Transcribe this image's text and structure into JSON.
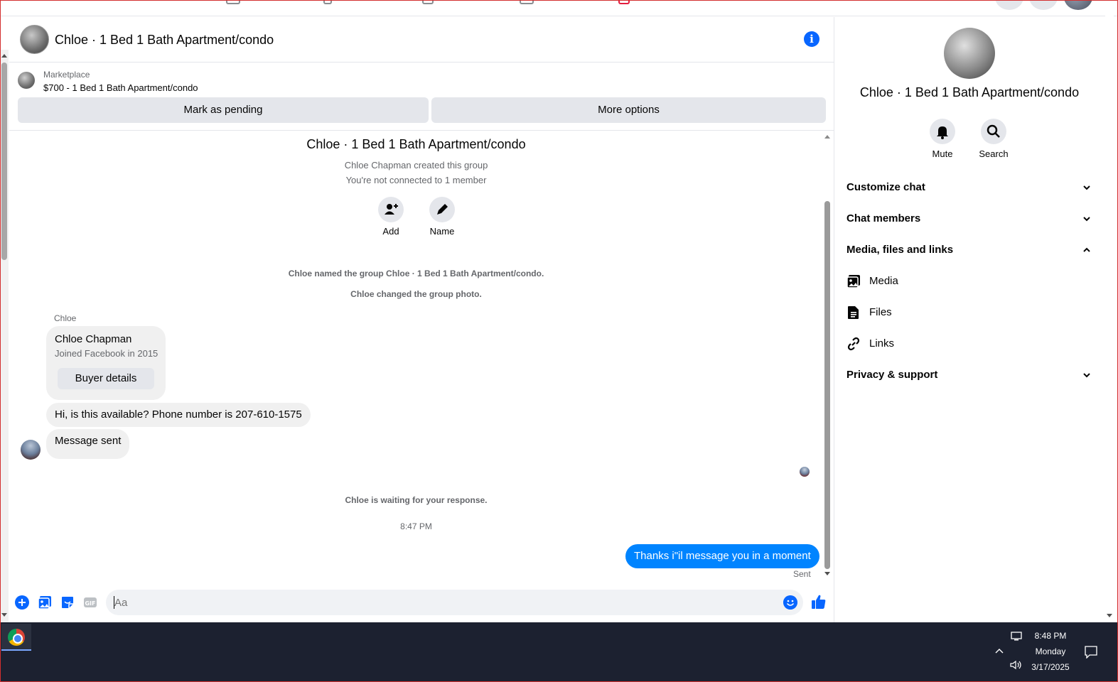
{
  "chat": {
    "title": "Chloe · 1 Bed 1 Bath Apartment/condo",
    "marketplace_label": "Marketplace",
    "listing": "$700 - 1 Bed 1 Bath Apartment/condo",
    "mark_pending": "Mark as pending",
    "more_options": "More options"
  },
  "thread": {
    "group_title": "Chloe · 1 Bed 1 Bath Apartment/condo",
    "created_by": "Chloe Chapman created this group",
    "not_connected": "You're not connected to 1 member",
    "add_label": "Add",
    "name_label": "Name",
    "event_named": "Chloe named the group Chloe · 1 Bed 1 Bath Apartment/condo.",
    "event_photo": "Chloe changed the group photo.",
    "sender": "Chloe",
    "card_name": "Chloe Chapman",
    "card_joined": "Joined Facebook in 2015",
    "buyer_details": "Buyer details",
    "msg_phone": "Hi, is this available? Phone number is 207-610-1575",
    "msg_sent": "Message sent",
    "waiting": "Chloe is waiting for your response.",
    "timestamp": "8:47 PM",
    "out_msg": "Thanks i\"il message you in a moment",
    "out_status": "Sent"
  },
  "composer": {
    "placeholder": "Aa"
  },
  "panel": {
    "title": "Chloe · 1 Bed 1 Bath Apartment/condo",
    "mute": "Mute",
    "search": "Search",
    "customize": "Customize chat",
    "members": "Chat members",
    "media_section": "Media, files and links",
    "media": "Media",
    "files": "Files",
    "links": "Links",
    "privacy": "Privacy & support"
  },
  "taskbar": {
    "time": "8:48 PM",
    "day": "Monday",
    "date": "3/17/2025"
  },
  "colors": {
    "accent": "#0866ff",
    "bubble_out": "#0084ff",
    "bubble_in": "#f0f0f0",
    "taskbar": "#1c2130"
  }
}
